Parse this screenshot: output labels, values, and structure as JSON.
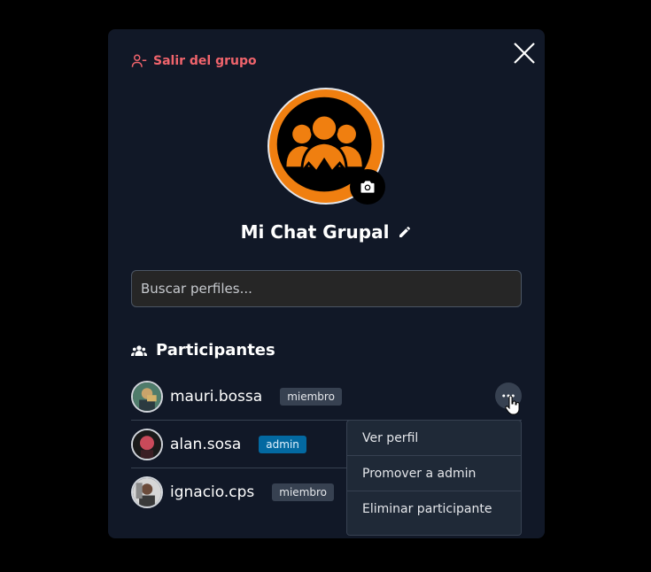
{
  "header": {
    "leave_label": "Salir del grupo"
  },
  "group": {
    "name": "Mi Chat Grupal"
  },
  "search": {
    "placeholder": "Buscar perfiles..."
  },
  "participants": {
    "title": "Participantes",
    "items": [
      {
        "username": "mauri.bossa",
        "role": "miembro"
      },
      {
        "username": "alan.sosa",
        "role": "admin"
      },
      {
        "username": "ignacio.cps",
        "role": "miembro"
      }
    ]
  },
  "menu": {
    "items": [
      {
        "label": "Ver perfil"
      },
      {
        "label": "Promover a admin"
      },
      {
        "label": "Eliminar participante"
      }
    ]
  },
  "colors": {
    "background": "#000000",
    "modal": "#111827",
    "danger": "#f0646c",
    "accent_orange": "#f07f10",
    "admin_badge": "#0369a1"
  },
  "icons": [
    "user-minus-icon",
    "close-icon",
    "group-icon",
    "camera-icon",
    "pencil-icon",
    "users-icon",
    "more-icon"
  ]
}
